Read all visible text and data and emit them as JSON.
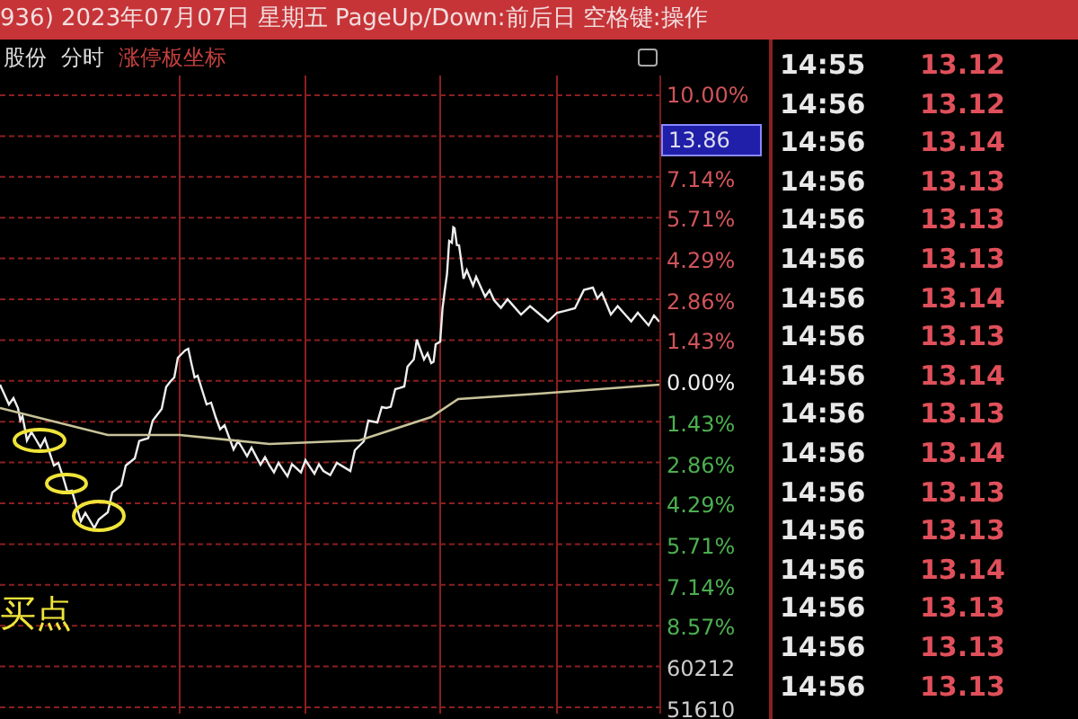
{
  "title_bar": {
    "text": "936) 2023年07月07日 星期五 PageUp/Down:前后日 空格键:操作"
  },
  "chart_header": {
    "tabs": [
      {
        "label": "股份",
        "kind": "plain"
      },
      {
        "label": "分时",
        "kind": "plain"
      },
      {
        "label": "涨停板坐标",
        "kind": "highlight"
      }
    ]
  },
  "axis_labels": [
    {
      "text": "10.00%",
      "kind": "up"
    },
    {
      "text": "13.86",
      "kind": "cursor"
    },
    {
      "text": "7.14%",
      "kind": "up"
    },
    {
      "text": "5.71%",
      "kind": "up"
    },
    {
      "text": "4.29%",
      "kind": "up"
    },
    {
      "text": "2.86%",
      "kind": "up"
    },
    {
      "text": "1.43%",
      "kind": "up"
    },
    {
      "text": "0.00%",
      "kind": "flat"
    },
    {
      "text": "1.43%",
      "kind": "down"
    },
    {
      "text": "2.86%",
      "kind": "down"
    },
    {
      "text": "4.29%",
      "kind": "down"
    },
    {
      "text": "5.71%",
      "kind": "down"
    },
    {
      "text": "7.14%",
      "kind": "down"
    },
    {
      "text": "8.57%",
      "kind": "down"
    },
    {
      "text": "60212",
      "kind": "volume"
    },
    {
      "text": "51610",
      "kind": "volume"
    }
  ],
  "annotation": {
    "text": "买点"
  },
  "ticks": [
    {
      "time": "14:55",
      "price": "13.12"
    },
    {
      "time": "14:56",
      "price": "13.12"
    },
    {
      "time": "14:56",
      "price": "13.14"
    },
    {
      "time": "14:56",
      "price": "13.13"
    },
    {
      "time": "14:56",
      "price": "13.13"
    },
    {
      "time": "14:56",
      "price": "13.13"
    },
    {
      "time": "14:56",
      "price": "13.14"
    },
    {
      "time": "14:56",
      "price": "13.13"
    },
    {
      "time": "14:56",
      "price": "13.14"
    },
    {
      "time": "14:56",
      "price": "13.13"
    },
    {
      "time": "14:56",
      "price": "13.14"
    },
    {
      "time": "14:56",
      "price": "13.13"
    },
    {
      "time": "14:56",
      "price": "13.13"
    },
    {
      "time": "14:56",
      "price": "13.14"
    },
    {
      "time": "14:56",
      "price": "13.13"
    },
    {
      "time": "14:56",
      "price": "13.13"
    },
    {
      "time": "14:56",
      "price": "13.13"
    }
  ]
}
